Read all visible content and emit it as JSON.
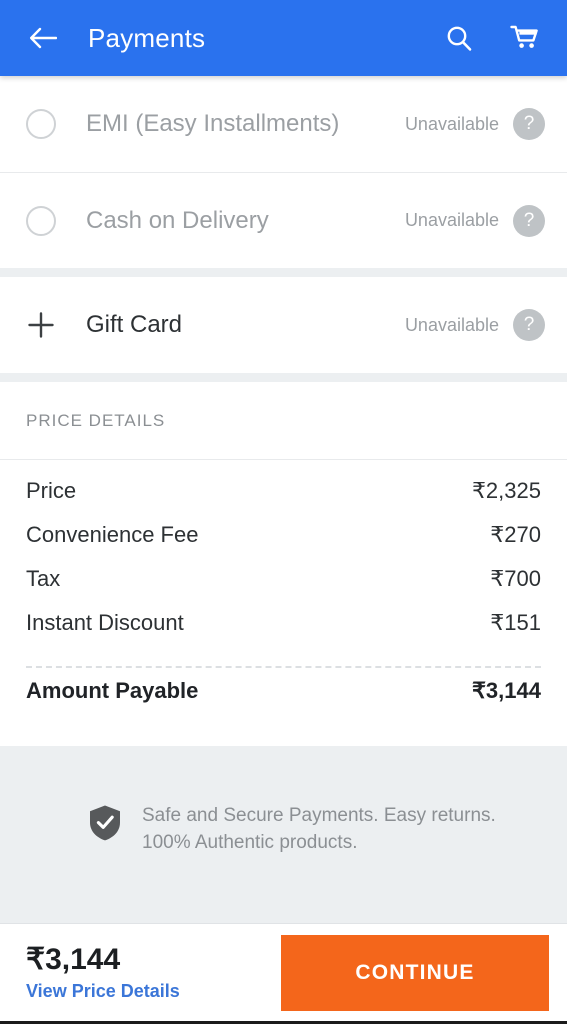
{
  "header": {
    "title": "Payments",
    "back_icon": "arrow-back-icon",
    "search_icon": "search-icon",
    "cart_icon": "shopping-cart-icon"
  },
  "payment_options": [
    {
      "label": "EMI (Easy Installments)",
      "status": "Unavailable",
      "control": "radio",
      "enabled": false,
      "help_glyph": "?"
    },
    {
      "label": "Cash on Delivery",
      "status": "Unavailable",
      "control": "radio",
      "enabled": false,
      "help_glyph": "?"
    }
  ],
  "gift_card": {
    "label": "Gift Card",
    "status": "Unavailable",
    "control": "plus",
    "enabled": true,
    "help_glyph": "?"
  },
  "price_details": {
    "section_title": "PRICE DETAILS",
    "rows": [
      {
        "name": "Price",
        "value": "₹2,325"
      },
      {
        "name": "Convenience Fee",
        "value": "₹270"
      },
      {
        "name": "Tax",
        "value": "₹700"
      },
      {
        "name": "Instant Discount",
        "value": "₹151"
      }
    ],
    "total": {
      "name": "Amount Payable",
      "value": "₹3,144"
    }
  },
  "secure_banner": {
    "icon": "shield-check-icon",
    "line1": "Safe and Secure Payments. Easy returns.",
    "line2": "100% Authentic products."
  },
  "bottom_bar": {
    "amount": "₹3,144",
    "link": "View Price Details",
    "continue_label": "CONTINUE"
  },
  "colors": {
    "appbar_blue": "#2a72ee",
    "accent_orange": "#f4661b",
    "link_blue": "#3b76d8",
    "muted_grey": "#9b9fa3",
    "page_bg": "#eceff1"
  }
}
